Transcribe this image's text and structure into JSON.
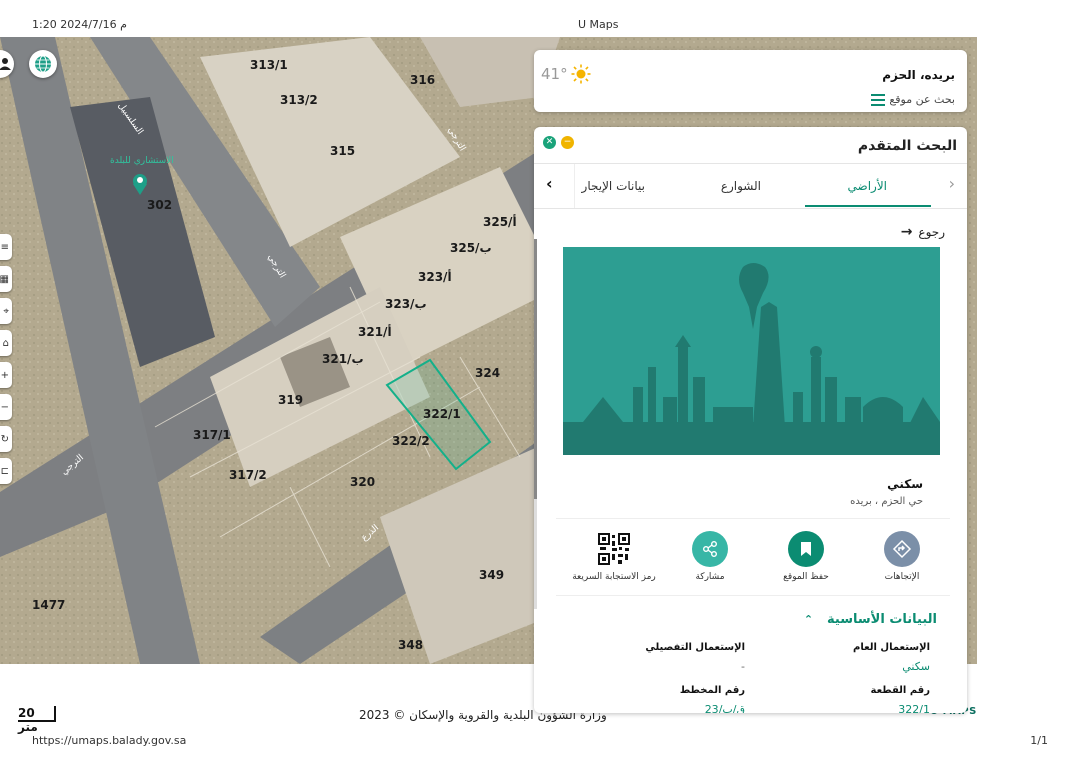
{
  "print": {
    "datetime": "1:20 2024/7/16 م",
    "title": "U Maps",
    "url": "https://umaps.balady.gov.sa",
    "page": "1/1"
  },
  "map": {
    "plots": [
      "313/1",
      "313/2",
      "316",
      "315",
      "302",
      "325/أ",
      "325/ب",
      "323/أ",
      "323/ب",
      "321/أ",
      "321/ب",
      "324",
      "322/1",
      "322/2",
      "319",
      "317/1",
      "317/2",
      "320",
      "349",
      "1477",
      "348"
    ],
    "streets": [
      "السلسبيل",
      "الترجي",
      "الترجي",
      "الترجي",
      "الذرع"
    ],
    "poi": "الاستشاري للبلدة",
    "scale": "20 متر",
    "copyright": "وزارة الشؤون البلدية والقروية والإسكان © 2023",
    "logo": "U MAPS"
  },
  "weather": {
    "location": "بريده، الحزم",
    "search_label": "بحث عن موقع",
    "temperature": "41°",
    "icon": "sun-icon"
  },
  "panel": {
    "title": "البحث المتقدم",
    "tabs": [
      {
        "label": "الأراضي",
        "active": true
      },
      {
        "label": "الشوارع",
        "active": false
      },
      {
        "label": "بيانات الإيجار",
        "active": false
      }
    ],
    "back_label": "رجوع",
    "place": {
      "name": "سكني",
      "subtitle": "حي الحزم ، بريده"
    },
    "actions": [
      {
        "label": "الإتجاهات",
        "icon": "directions-icon",
        "color": "#7b8fa8"
      },
      {
        "label": "حفظ الموقع",
        "icon": "bookmark-icon",
        "color": "#0b8c72"
      },
      {
        "label": "مشاركة",
        "icon": "share-icon",
        "color": "#37b6a6"
      },
      {
        "label": "رمز الاستجابة السريعة",
        "icon": "qr-code-icon",
        "color": "#111111"
      }
    ],
    "basic": {
      "title": "البيانات الأساسية",
      "general_use_label": "الإستعمال العام",
      "general_use_value": "سكني",
      "detailed_use_label": "الإستعمال التفصيلي",
      "detailed_use_value": "-",
      "plot_number_label": "رقم القطعة",
      "plot_number_value": "322/1",
      "plan_number_label": "رقم المخطط",
      "plan_number_value": "ق/ب/23"
    }
  },
  "colors": {
    "accent": "#0b8c72",
    "highlight": "#14b08a"
  }
}
